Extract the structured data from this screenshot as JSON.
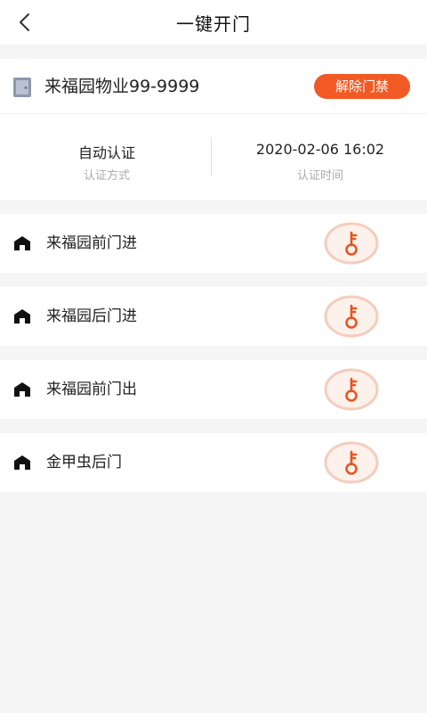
{
  "header": {
    "title": "一键开门"
  },
  "community": {
    "name": "来福园物业99-9999",
    "release_label": "解除门禁",
    "auth_method_value": "自动认证",
    "auth_method_label": "认证方式",
    "auth_time_value": "2020-02-06 16:02",
    "auth_time_label": "认证时间"
  },
  "gates": [
    {
      "name": "来福园前门进"
    },
    {
      "name": "来福园后门进"
    },
    {
      "name": "来福园前门出"
    },
    {
      "name": "金甲虫后门"
    }
  ],
  "colors": {
    "accent": "#f15a24",
    "key_ring": "#f4cdbd",
    "key_icon": "#e8551f"
  },
  "icons": {
    "back": "chevron-left-icon",
    "community": "door-icon",
    "gate": "house-icon",
    "key": "key-icon"
  }
}
